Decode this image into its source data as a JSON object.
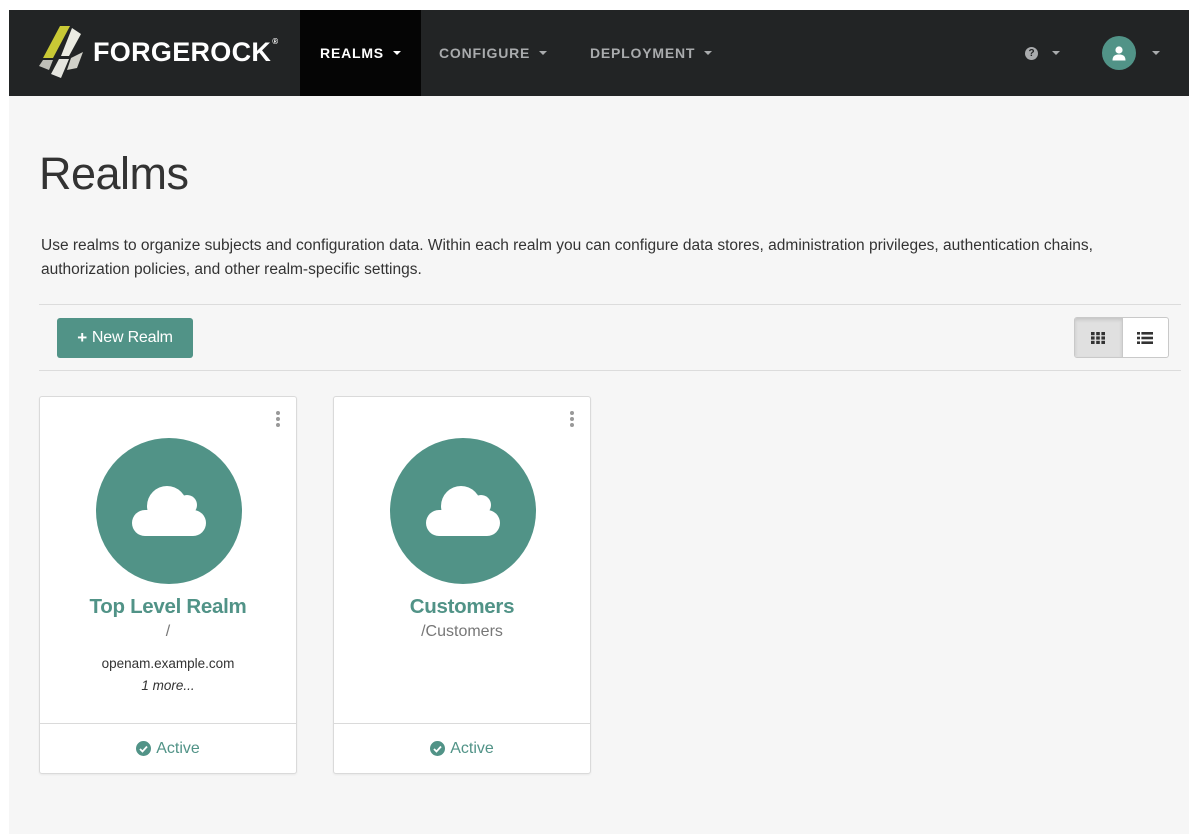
{
  "navbar": {
    "brand": "FORGEROCK",
    "brand_tm": "®",
    "items": [
      {
        "label": "REALMS",
        "active": true
      },
      {
        "label": "CONFIGURE",
        "active": false
      },
      {
        "label": "DEPLOYMENT",
        "active": false
      }
    ],
    "help_icon": "question-circle-icon",
    "user_icon": "user-icon"
  },
  "page": {
    "title": "Realms",
    "description": "Use realms to organize subjects and configuration data. Within each realm you can configure data stores, administration privileges, authentication chains, authorization policies, and other realm-specific settings."
  },
  "toolbar": {
    "new_realm_plus": "+",
    "new_realm_label": "New Realm",
    "view_grid_icon": "grid-icon",
    "view_list_icon": "list-icon",
    "active_view": "grid"
  },
  "realms": [
    {
      "name": "Top Level Realm",
      "path": "/",
      "alias": "openam.example.com",
      "more": "1 more...",
      "status": "Active",
      "icon": "cloud-icon"
    },
    {
      "name": "Customers",
      "path": "/Customers",
      "alias": "",
      "more": "",
      "status": "Active",
      "icon": "cloud-icon"
    }
  ],
  "colors": {
    "brand_green": "#519387",
    "navbar_bg": "#222425",
    "navbar_active_bg": "#050505",
    "page_bg": "#f6f6f6"
  }
}
